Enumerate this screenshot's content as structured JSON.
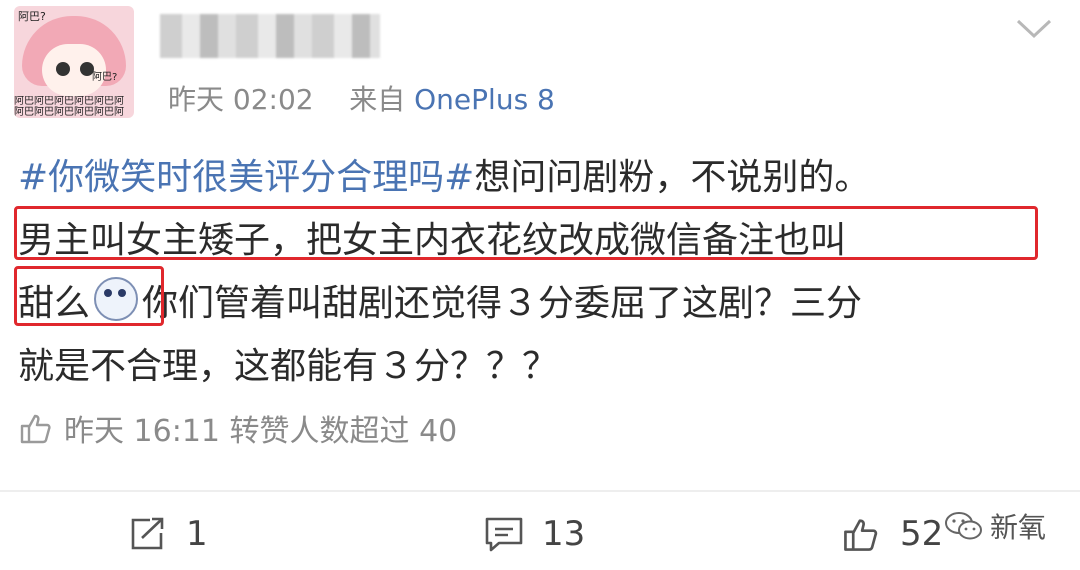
{
  "avatar": {
    "tag_top": "阿巴?",
    "tag_side": "阿巴?",
    "strip_line1": "阿巴阿巴阿巴阿巴阿巴阿",
    "strip_line2": "阿巴阿巴阿巴阿巴阿巴阿"
  },
  "header": {
    "time": "昨天 02:02",
    "from_label": "来自",
    "device": "OnePlus 8"
  },
  "post": {
    "hashtag": "#你微笑时很美评分合理吗#",
    "line1_rest": "想问问剧粉，不说别的。",
    "line2": "男主叫女主矮子，把女主内衣花纹改成微信备注也叫",
    "line3_start": "甜么",
    "line3_rest": "你们管着叫甜剧还觉得３分委屈了这剧？三分",
    "line4": "就是不合理，这都能有３分？？？"
  },
  "likes_info": "昨天 16:11 转赞人数超过 40",
  "actions": {
    "repost_count": "1",
    "comment_count": "13",
    "like_count": "52"
  },
  "watermark": "新氧",
  "colors": {
    "link_blue": "#4a74b3",
    "highlight_red": "#e0282d",
    "meta_gray": "#8a8a8a"
  },
  "icons": [
    "chevron-down-icon",
    "thumbs-up-icon",
    "repost-icon",
    "comment-icon",
    "wechat-icon"
  ]
}
